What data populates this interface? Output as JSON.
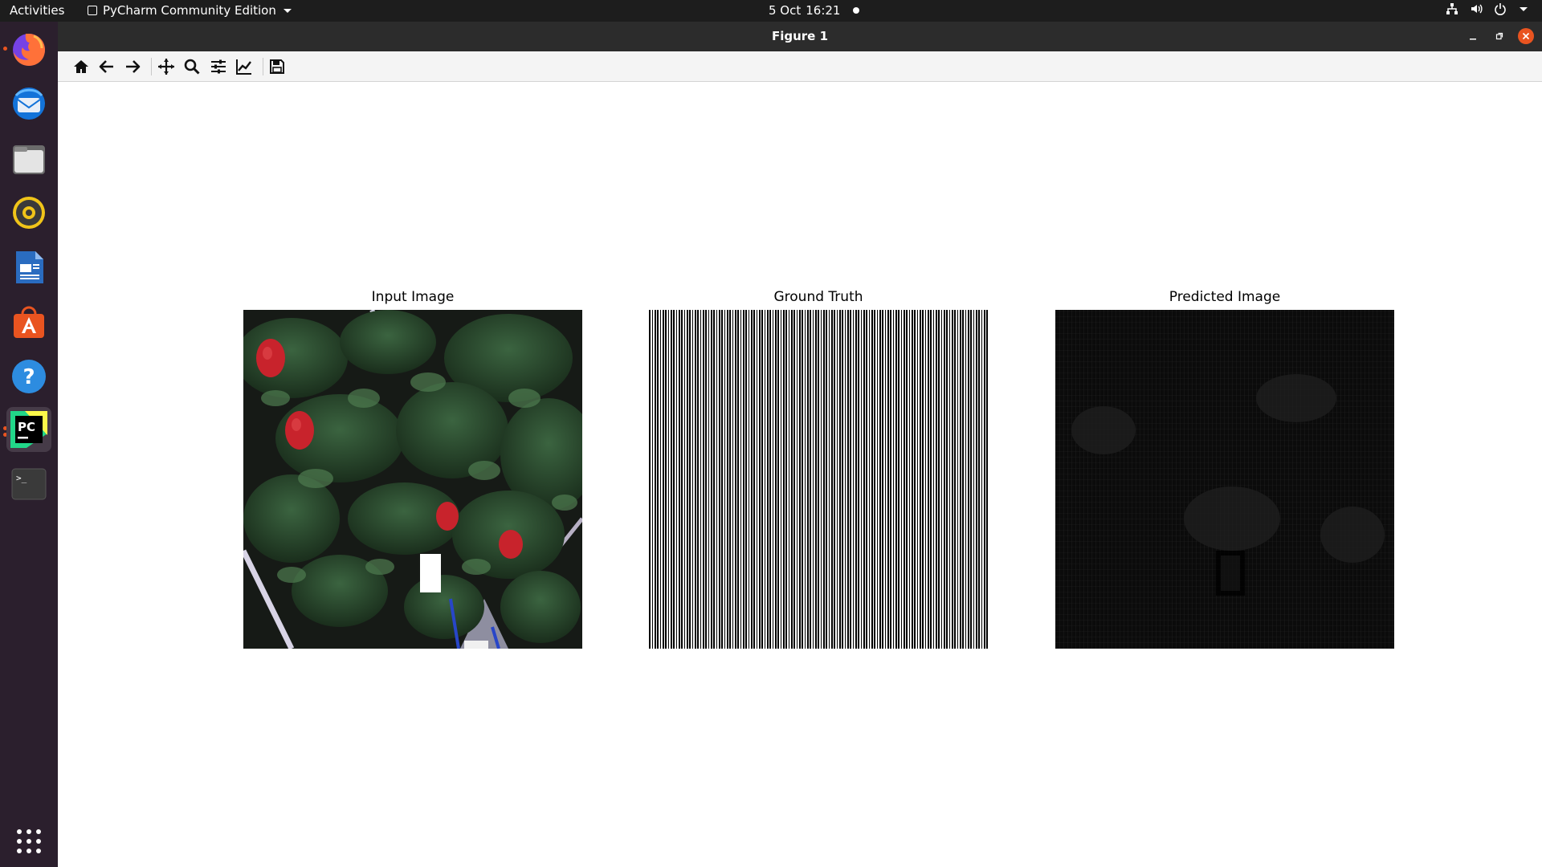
{
  "topbar": {
    "activities": "Activities",
    "app_menu": "PyCharm Community Edition",
    "date": "5 Oct",
    "time": "16:21"
  },
  "dock": {
    "apps": [
      {
        "name": "firefox-icon",
        "running": true
      },
      {
        "name": "thunderbird-icon",
        "running": false
      },
      {
        "name": "files-icon",
        "running": false
      },
      {
        "name": "rhythmbox-icon",
        "running": false
      },
      {
        "name": "libreoffice-writer-icon",
        "running": false
      },
      {
        "name": "software-center-icon",
        "running": false
      },
      {
        "name": "help-icon",
        "running": false
      },
      {
        "name": "pycharm-icon",
        "running": true,
        "active": true,
        "label": "PC"
      },
      {
        "name": "terminal-icon",
        "running": false,
        "label": ">_"
      }
    ]
  },
  "window": {
    "title": "Figure 1"
  },
  "toolbar": {
    "tools": [
      "home-icon",
      "back-arrow-icon",
      "forward-arrow-icon",
      "pan-icon",
      "zoom-icon",
      "subplots-config-icon",
      "edit-axis-icon",
      "save-icon"
    ]
  },
  "figure": {
    "panels": [
      {
        "title": "Input Image"
      },
      {
        "title": "Ground Truth"
      },
      {
        "title": "Predicted Image"
      }
    ]
  },
  "colors": {
    "accent": "#e95420",
    "topbar_bg": "#1d1d1d",
    "dock_bg": "#2b1f2d",
    "titlebar_bg": "#2c2c2c"
  }
}
